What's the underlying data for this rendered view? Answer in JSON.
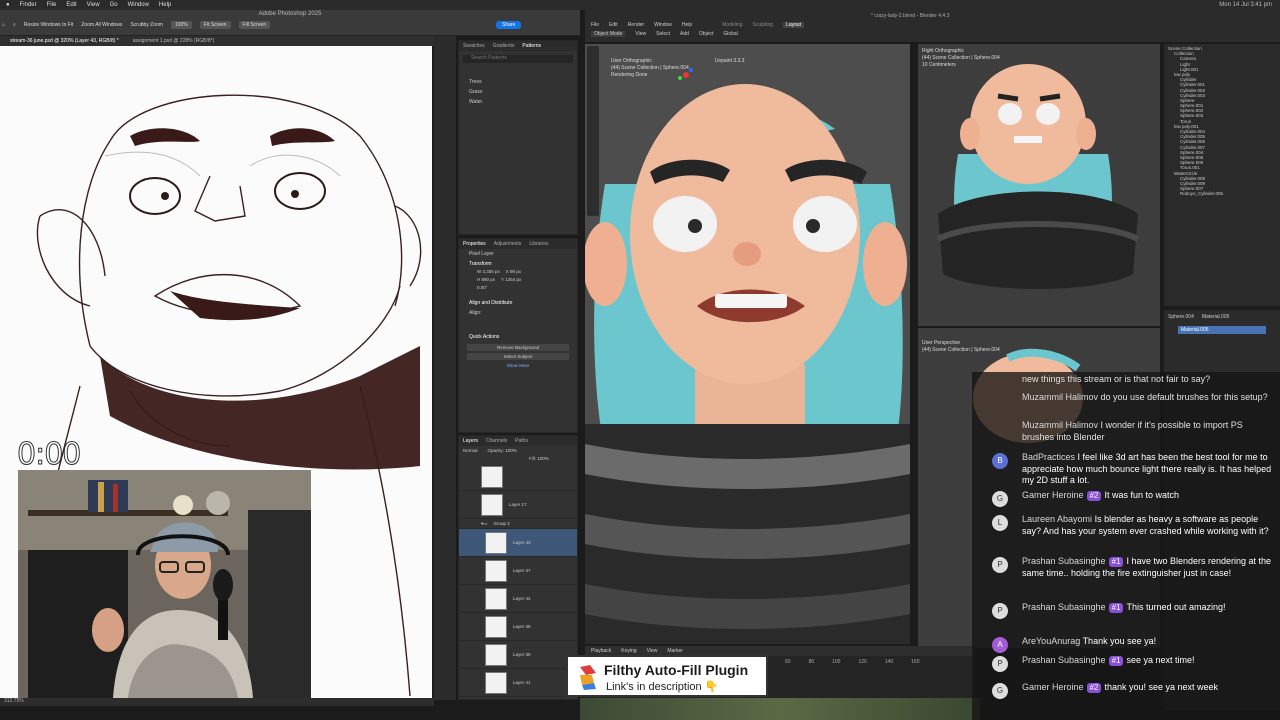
{
  "menubar": {
    "items": [
      "Finder",
      "File",
      "Edit",
      "View",
      "Go",
      "Window",
      "Help"
    ],
    "clock": "Mon 14 Jul 3:41 pm"
  },
  "photoshop": {
    "title": "Adobe Photoshop 2025",
    "options": [
      "Resize Windows to Fit",
      "Zoom All Windows",
      "Scrubby Zoom",
      "100%",
      "Fit Screen",
      "Fill Screen"
    ],
    "share": "Share",
    "doc_tabs": [
      "stream-36 june.psd @ 320% (Layer 43, RGB/8) *",
      "assignment 1.psd @ 228% (RGB/8*)"
    ],
    "status": "312.79%",
    "patterns_tabs": [
      "Swatches",
      "Gradients",
      "Patterns"
    ],
    "search_placeholder": "Search Patterns",
    "pattern_groups": [
      "Trees",
      "Grass",
      "Water"
    ],
    "props_tabs": [
      "Properties",
      "Adjustments",
      "Libraries"
    ],
    "props": {
      "pixel_layer": "Pixel Layer",
      "transform": "Transform",
      "w": "W 3,355 px",
      "x": "X 98 px",
      "h": "H 890 px",
      "y": "Y 1254 px",
      "angle": "0.00°",
      "align": "Align and Distribute",
      "align_sub": "Align:",
      "quick": "Quick Actions",
      "remove_bg": "Remove Background",
      "select_subject": "Select Subject",
      "show_more": "Show More"
    },
    "layers_tabs": [
      "Layers",
      "Channels",
      "Paths"
    ],
    "layer_mode": "Normal",
    "opacity": "Opacity: 100%",
    "fill": "Fill: 100%",
    "layers": [
      "",
      "Layer 17",
      "Group 2",
      "Layer 43",
      "Layer 37",
      "Layer 42",
      "Layer 38",
      "Layer 39",
      "Layer 41",
      ""
    ]
  },
  "timer": "0:00",
  "blender": {
    "title": "* crazy-lady-2.blend - Blender 4.4.3",
    "menus": [
      "File",
      "Edit",
      "Render",
      "Window",
      "Help"
    ],
    "workspaces": [
      "Layout",
      "Modeling",
      "Sculpting",
      "Layout"
    ],
    "mode": "Object Mode",
    "vp_menus": [
      "View",
      "Select",
      "Add",
      "Object"
    ],
    "transform": "Global",
    "vp1": {
      "line1": "User Orthographic",
      "line2": "(44) Scene Collection | Sphere.004",
      "line3": "Rendering Done",
      "uv": "Uvpaint 3.3.3"
    },
    "vp2": {
      "line1": "Right Orthographic",
      "line2": "(44) Scene Collection | Sphere.004",
      "line3": "10 Centimeters"
    },
    "vp3": {
      "line1": "User Perspective",
      "line2": "(44) Scene Collection | Sphere.004"
    },
    "outliner": [
      "Scene Collection",
      "Collection",
      "Camera",
      "Light",
      "Light.001",
      "low poly",
      "Cylinder",
      "Cylinder.001",
      "Cylinder.002",
      "Cylinder.003",
      "Sphere",
      "Sphere.001",
      "Sphere.002",
      "Sphere.003",
      "Torus",
      "low poly.001",
      "Cylinder.004",
      "Cylinder.005",
      "Cylinder.006",
      "Cylinder.007",
      "Sphere.004",
      "Sphere.005",
      "Sphere.006",
      "Torus.001",
      "WaterCircle",
      "Cylinder.008",
      "Cylinder.009",
      "Sphere.007",
      "Roboyo_Cylinder.006"
    ],
    "material": {
      "obj": "Sphere.004",
      "mat": "Material.005",
      "slot": "Material.005"
    },
    "timeline": {
      "menus": [
        "Playback",
        "Keying",
        "View",
        "Marker"
      ],
      "ticks": [
        "60",
        "80",
        "100",
        "120",
        "140",
        "160",
        "180",
        "200"
      ]
    }
  },
  "chat": {
    "ghost1": "new things this stream or is that not fair to say?",
    "ghost2_name": "Muzammil Halimov",
    "ghost2_text": "do you use default brushes for this setup?",
    "ghost3_name": "Muzammil Halimov",
    "ghost3_text": "I wonder if it's possible to import PS brushes into Blender",
    "messages": [
      {
        "avatar": "B",
        "name": "BadPractices",
        "badge": "",
        "text": "I feel like 3d art has been the best tool for me to appreciate how much bounce light there really is. It has helped my 2D stuff a lot."
      },
      {
        "avatar": "G",
        "name": "Gamer Heroine",
        "badge": "#2",
        "text": "It was fun to watch"
      },
      {
        "avatar": "L",
        "name": "Laureen Abayomi",
        "badge": "",
        "text": "Is blender as heavy a software as people say? And has your system ever crashed while working with it?"
      },
      {
        "avatar": "P",
        "name": "Prashan Subasinghe",
        "badge": "#1",
        "text": "I have two Blenders rendering at the same time.. holding the fire extinguisher just in case!"
      },
      {
        "avatar": "P",
        "name": "Prashan Subasinghe",
        "badge": "#1",
        "text": "This turned out amazing!"
      },
      {
        "avatar": "A",
        "name": "AreYouAnurag",
        "badge": "",
        "text": "Thank you see ya!"
      },
      {
        "avatar": "P",
        "name": "Prashan Subasinghe",
        "badge": "#1",
        "text": "see ya next time!"
      },
      {
        "avatar": "G",
        "name": "Gamer Heroine",
        "badge": "#2",
        "text": "thank you! see ya next week"
      }
    ]
  },
  "plugin": {
    "title": "Filthy Auto-Fill Plugin",
    "subtitle": "Link's in description 👇"
  },
  "colors": {
    "accent": "#1473e6",
    "badge": "#8a4fd8",
    "hair": "#7fd3d6",
    "skin": "#f2b99a"
  }
}
